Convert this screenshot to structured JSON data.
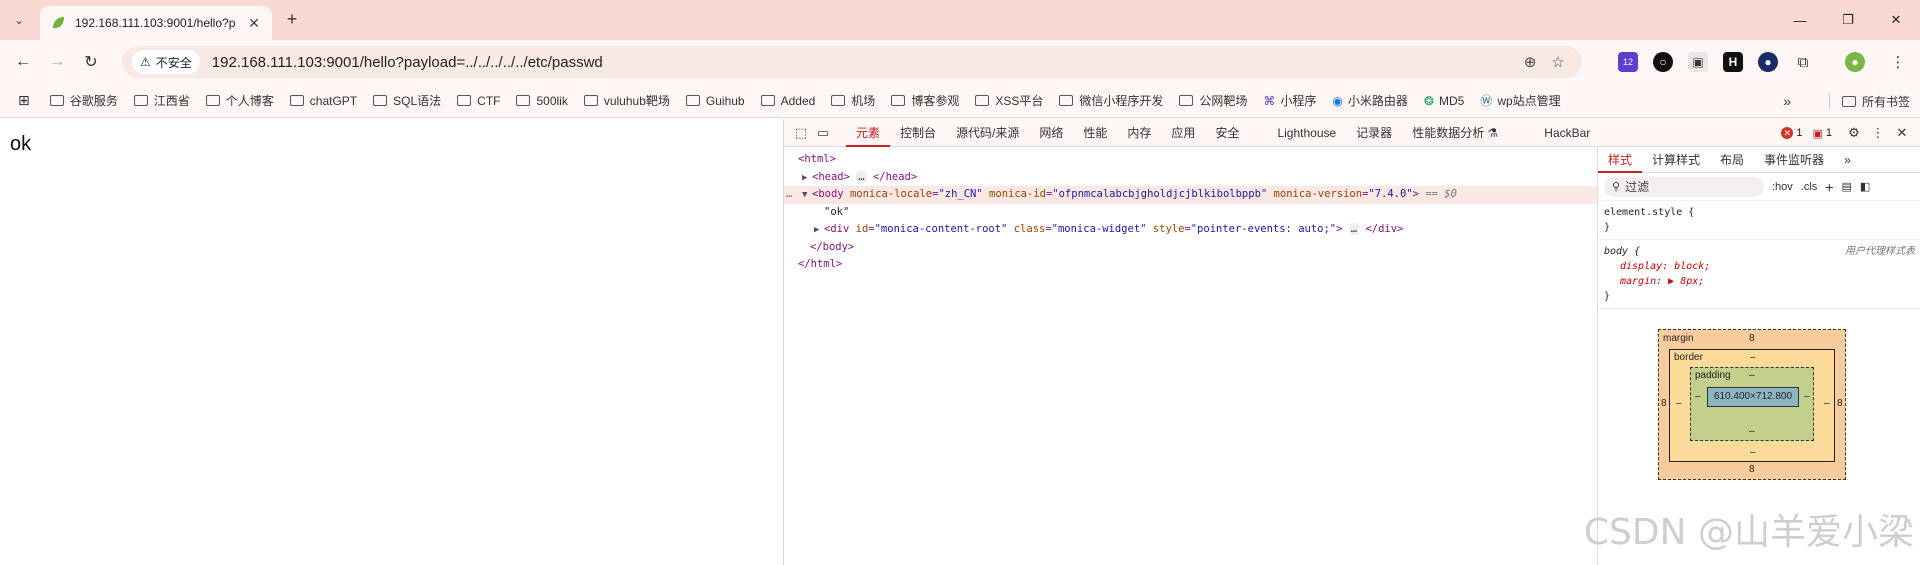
{
  "browser": {
    "tab": {
      "title": "192.168.111.103:9001/hello?p"
    },
    "omnibox": {
      "security_label": "不安全",
      "url": "192.168.111.103:9001/hello?payload=../../../../../etc/passwd"
    },
    "extension_badge": "12",
    "bookmarks": [
      {
        "label": "谷歌服务",
        "icon": "folder-icon"
      },
      {
        "label": "江西省",
        "icon": "folder-icon"
      },
      {
        "label": "个人博客",
        "icon": "folder-icon"
      },
      {
        "label": "chatGPT",
        "icon": "folder-icon"
      },
      {
        "label": "SQL语法",
        "icon": "folder-icon"
      },
      {
        "label": "CTF",
        "icon": "folder-icon"
      },
      {
        "label": "500lik",
        "icon": "folder-icon"
      },
      {
        "label": "vuluhub靶场",
        "icon": "folder-icon"
      },
      {
        "label": "Guihub",
        "icon": "folder-icon"
      },
      {
        "label": "Added",
        "icon": "folder-icon"
      },
      {
        "label": "机场",
        "icon": "folder-icon"
      },
      {
        "label": "博客参观",
        "icon": "folder-icon"
      },
      {
        "label": "XSS平台",
        "icon": "folder-icon"
      },
      {
        "label": "微信小程序开发",
        "icon": "folder-icon"
      },
      {
        "label": "公网靶场",
        "icon": "folder-icon"
      },
      {
        "label": "小程序",
        "icon": "miniprogram-icon"
      },
      {
        "label": "小米路由器",
        "icon": "wifi-icon"
      },
      {
        "label": "MD5",
        "icon": "md5-icon"
      },
      {
        "label": "wp站点管理",
        "icon": "wordpress-icon"
      }
    ],
    "all_bookmarks": "所有书签"
  },
  "page": {
    "text": "ok"
  },
  "devtools": {
    "tabs": [
      "元素",
      "控制台",
      "源代码/来源",
      "网络",
      "性能",
      "内存",
      "应用",
      "安全",
      "Lighthouse",
      "记录器",
      "性能数据分析 ⚗",
      "HackBar"
    ],
    "active_tab": "元素",
    "error_count": "1",
    "message_count": "1",
    "dom": {
      "html_open": "<html>",
      "head": "<head>",
      "head_close": "</head>",
      "body_open": "<body",
      "attr1_name": "monica-locale",
      "attr1_value": "\"zh_CN\"",
      "attr2_name": "monica-id",
      "attr2_value": "\"ofpnmcalabcbjgholdjcjblkibolbppb\"",
      "attr3_name": "monica-version",
      "attr3_value": "\"7.4.0\"",
      "eq_dollar": "== $0",
      "text_node": "\"ok\"",
      "div_open": "<div",
      "div_id_name": "id",
      "div_id_value": "\"monica-content-root\"",
      "div_class_name": "class",
      "div_class_value": "\"monica-widget\"",
      "div_style_name": "style",
      "div_style_value": "\"pointer-events: auto;\"",
      "div_close": "</div>",
      "body_close": "</body>",
      "html_close": "</html>"
    },
    "styles": {
      "tabs": [
        "样式",
        "计算样式",
        "布局",
        "事件监听器",
        "»"
      ],
      "filter_placeholder": "过滤",
      "hov": ":hov",
      "cls": ".cls",
      "element_style": "element.style {",
      "element_style_close": "}",
      "body_selector": "body {",
      "ua_label": "用户代理样式表",
      "prop1": "display: block;",
      "prop2": "margin: ▶ 8px;",
      "body_close": "}"
    },
    "box_model": {
      "margin_label": "margin",
      "margin_top": "8",
      "margin_bottom": "8",
      "margin_left": "8",
      "margin_right": "8",
      "border_label": "border",
      "border_top": "–",
      "border_bottom": "–",
      "border_left": "–",
      "border_right": "–",
      "padding_label": "padding",
      "padding_top": "–",
      "padding_bottom": "–",
      "padding_left": "–",
      "padding_right": "–",
      "content": "610.400×712.800"
    }
  },
  "watermark": "CSDN @山羊爱小梁"
}
